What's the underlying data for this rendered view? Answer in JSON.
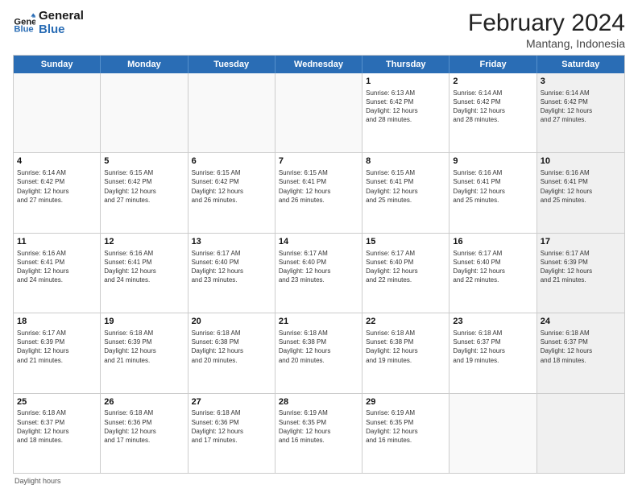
{
  "logo": {
    "line1": "General",
    "line2": "Blue"
  },
  "title": "February 2024",
  "subtitle": "Mantang, Indonesia",
  "days_of_week": [
    "Sunday",
    "Monday",
    "Tuesday",
    "Wednesday",
    "Thursday",
    "Friday",
    "Saturday"
  ],
  "weeks": [
    [
      {
        "day": "",
        "info": "",
        "empty": true
      },
      {
        "day": "",
        "info": "",
        "empty": true
      },
      {
        "day": "",
        "info": "",
        "empty": true
      },
      {
        "day": "",
        "info": "",
        "empty": true
      },
      {
        "day": "1",
        "info": "Sunrise: 6:13 AM\nSunset: 6:42 PM\nDaylight: 12 hours\nand 28 minutes."
      },
      {
        "day": "2",
        "info": "Sunrise: 6:14 AM\nSunset: 6:42 PM\nDaylight: 12 hours\nand 28 minutes."
      },
      {
        "day": "3",
        "info": "Sunrise: 6:14 AM\nSunset: 6:42 PM\nDaylight: 12 hours\nand 27 minutes.",
        "shaded": true
      }
    ],
    [
      {
        "day": "4",
        "info": "Sunrise: 6:14 AM\nSunset: 6:42 PM\nDaylight: 12 hours\nand 27 minutes."
      },
      {
        "day": "5",
        "info": "Sunrise: 6:15 AM\nSunset: 6:42 PM\nDaylight: 12 hours\nand 27 minutes."
      },
      {
        "day": "6",
        "info": "Sunrise: 6:15 AM\nSunset: 6:42 PM\nDaylight: 12 hours\nand 26 minutes."
      },
      {
        "day": "7",
        "info": "Sunrise: 6:15 AM\nSunset: 6:41 PM\nDaylight: 12 hours\nand 26 minutes."
      },
      {
        "day": "8",
        "info": "Sunrise: 6:15 AM\nSunset: 6:41 PM\nDaylight: 12 hours\nand 25 minutes."
      },
      {
        "day": "9",
        "info": "Sunrise: 6:16 AM\nSunset: 6:41 PM\nDaylight: 12 hours\nand 25 minutes."
      },
      {
        "day": "10",
        "info": "Sunrise: 6:16 AM\nSunset: 6:41 PM\nDaylight: 12 hours\nand 25 minutes.",
        "shaded": true
      }
    ],
    [
      {
        "day": "11",
        "info": "Sunrise: 6:16 AM\nSunset: 6:41 PM\nDaylight: 12 hours\nand 24 minutes."
      },
      {
        "day": "12",
        "info": "Sunrise: 6:16 AM\nSunset: 6:41 PM\nDaylight: 12 hours\nand 24 minutes."
      },
      {
        "day": "13",
        "info": "Sunrise: 6:17 AM\nSunset: 6:40 PM\nDaylight: 12 hours\nand 23 minutes."
      },
      {
        "day": "14",
        "info": "Sunrise: 6:17 AM\nSunset: 6:40 PM\nDaylight: 12 hours\nand 23 minutes."
      },
      {
        "day": "15",
        "info": "Sunrise: 6:17 AM\nSunset: 6:40 PM\nDaylight: 12 hours\nand 22 minutes."
      },
      {
        "day": "16",
        "info": "Sunrise: 6:17 AM\nSunset: 6:40 PM\nDaylight: 12 hours\nand 22 minutes."
      },
      {
        "day": "17",
        "info": "Sunrise: 6:17 AM\nSunset: 6:39 PM\nDaylight: 12 hours\nand 21 minutes.",
        "shaded": true
      }
    ],
    [
      {
        "day": "18",
        "info": "Sunrise: 6:17 AM\nSunset: 6:39 PM\nDaylight: 12 hours\nand 21 minutes."
      },
      {
        "day": "19",
        "info": "Sunrise: 6:18 AM\nSunset: 6:39 PM\nDaylight: 12 hours\nand 21 minutes."
      },
      {
        "day": "20",
        "info": "Sunrise: 6:18 AM\nSunset: 6:38 PM\nDaylight: 12 hours\nand 20 minutes."
      },
      {
        "day": "21",
        "info": "Sunrise: 6:18 AM\nSunset: 6:38 PM\nDaylight: 12 hours\nand 20 minutes."
      },
      {
        "day": "22",
        "info": "Sunrise: 6:18 AM\nSunset: 6:38 PM\nDaylight: 12 hours\nand 19 minutes."
      },
      {
        "day": "23",
        "info": "Sunrise: 6:18 AM\nSunset: 6:37 PM\nDaylight: 12 hours\nand 19 minutes."
      },
      {
        "day": "24",
        "info": "Sunrise: 6:18 AM\nSunset: 6:37 PM\nDaylight: 12 hours\nand 18 minutes.",
        "shaded": true
      }
    ],
    [
      {
        "day": "25",
        "info": "Sunrise: 6:18 AM\nSunset: 6:37 PM\nDaylight: 12 hours\nand 18 minutes."
      },
      {
        "day": "26",
        "info": "Sunrise: 6:18 AM\nSunset: 6:36 PM\nDaylight: 12 hours\nand 17 minutes."
      },
      {
        "day": "27",
        "info": "Sunrise: 6:18 AM\nSunset: 6:36 PM\nDaylight: 12 hours\nand 17 minutes."
      },
      {
        "day": "28",
        "info": "Sunrise: 6:19 AM\nSunset: 6:35 PM\nDaylight: 12 hours\nand 16 minutes."
      },
      {
        "day": "29",
        "info": "Sunrise: 6:19 AM\nSunset: 6:35 PM\nDaylight: 12 hours\nand 16 minutes."
      },
      {
        "day": "",
        "info": "",
        "empty": true
      },
      {
        "day": "",
        "info": "",
        "empty": true,
        "shaded": true
      }
    ]
  ],
  "footer": "Daylight hours"
}
